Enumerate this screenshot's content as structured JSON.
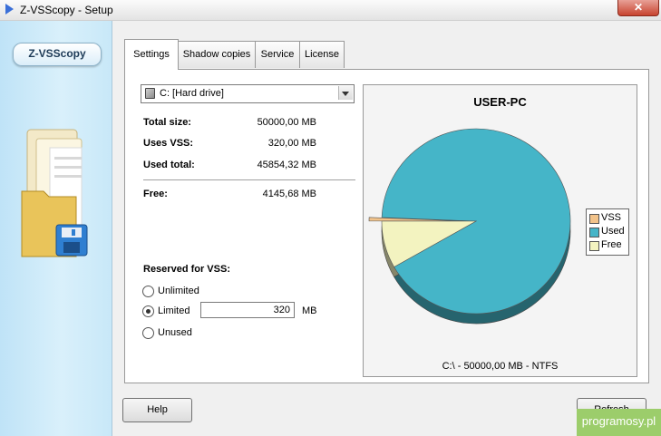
{
  "window": {
    "title": "Z-VSScopy - Setup",
    "close_label": "✕"
  },
  "sidebar": {
    "brand": "Z-VSScopy"
  },
  "tabs": [
    "Settings",
    "Shadow copies",
    "Service",
    "License"
  ],
  "drive": {
    "selected": "C:  [Hard drive]"
  },
  "stats": {
    "total_size_label": "Total size:",
    "total_size_value": "50000,00 MB",
    "uses_vss_label": "Uses VSS:",
    "uses_vss_value": "320,00 MB",
    "used_total_label": "Used total:",
    "used_total_value": "45854,32 MB",
    "free_label": "Free:",
    "free_value": "4145,68 MB"
  },
  "reserved": {
    "label": "Reserved for VSS:",
    "options": [
      "Unlimited",
      "Limited",
      "Unused"
    ],
    "selected": "Limited",
    "limit_value": "320",
    "unit": "MB"
  },
  "chart_data": {
    "type": "pie",
    "title": "USER-PC",
    "footer": "C:\\ - 50000,00 MB - NTFS",
    "legend_position": "right",
    "slices": [
      {
        "name": "VSS",
        "value": 320.0,
        "color": "#f2c38a"
      },
      {
        "name": "Used",
        "value": 45854.32,
        "color": "#45b5c8"
      },
      {
        "name": "Free",
        "value": 4145.68,
        "color": "#f3f3c0"
      }
    ]
  },
  "buttons": {
    "help": "Help",
    "refresh": "Refresh"
  },
  "watermark": "programosy.pl"
}
